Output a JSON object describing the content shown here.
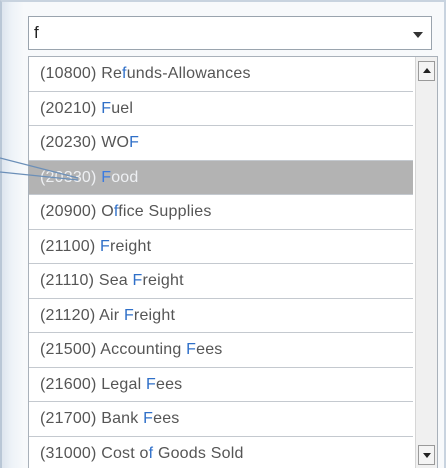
{
  "combo": {
    "value": "f",
    "arrow_icon": "chevron-down-icon"
  },
  "list": {
    "items": [
      {
        "before": "(10800) Re",
        "hl": "f",
        "after": "unds-Allowances"
      },
      {
        "before": "(20210) ",
        "hl": "F",
        "after": "uel"
      },
      {
        "before": "(20230) WO",
        "hl": "F",
        "after": ""
      },
      {
        "before": "(20330) ",
        "hl": "F",
        "after": "ood"
      },
      {
        "before": "(20900) O",
        "hl": "f",
        "after": "fice Supplies"
      },
      {
        "before": "(21100) ",
        "hl": "F",
        "after": "reight"
      },
      {
        "before": "(21110) Sea ",
        "hl": "F",
        "after": "reight"
      },
      {
        "before": "(21120) Air ",
        "hl": "F",
        "after": "reight"
      },
      {
        "before": "(21500) Accounting ",
        "hl": "F",
        "after": "ees"
      },
      {
        "before": "(21600) Legal ",
        "hl": "F",
        "after": "ees"
      },
      {
        "before": "(21700) Bank ",
        "hl": "F",
        "after": "ees"
      },
      {
        "before": "(31000) Cost o",
        "hl": "f",
        "after": " Goods Sold"
      }
    ],
    "selected_index": 3
  },
  "scrollbar": {
    "up_icon": "scroll-up-arrow-icon",
    "down_icon": "scroll-down-arrow-icon"
  },
  "colors": {
    "highlight_text": "#2f6fc8",
    "selected_row": "#b3b3b3",
    "callout_line": "#6b8fb8"
  }
}
